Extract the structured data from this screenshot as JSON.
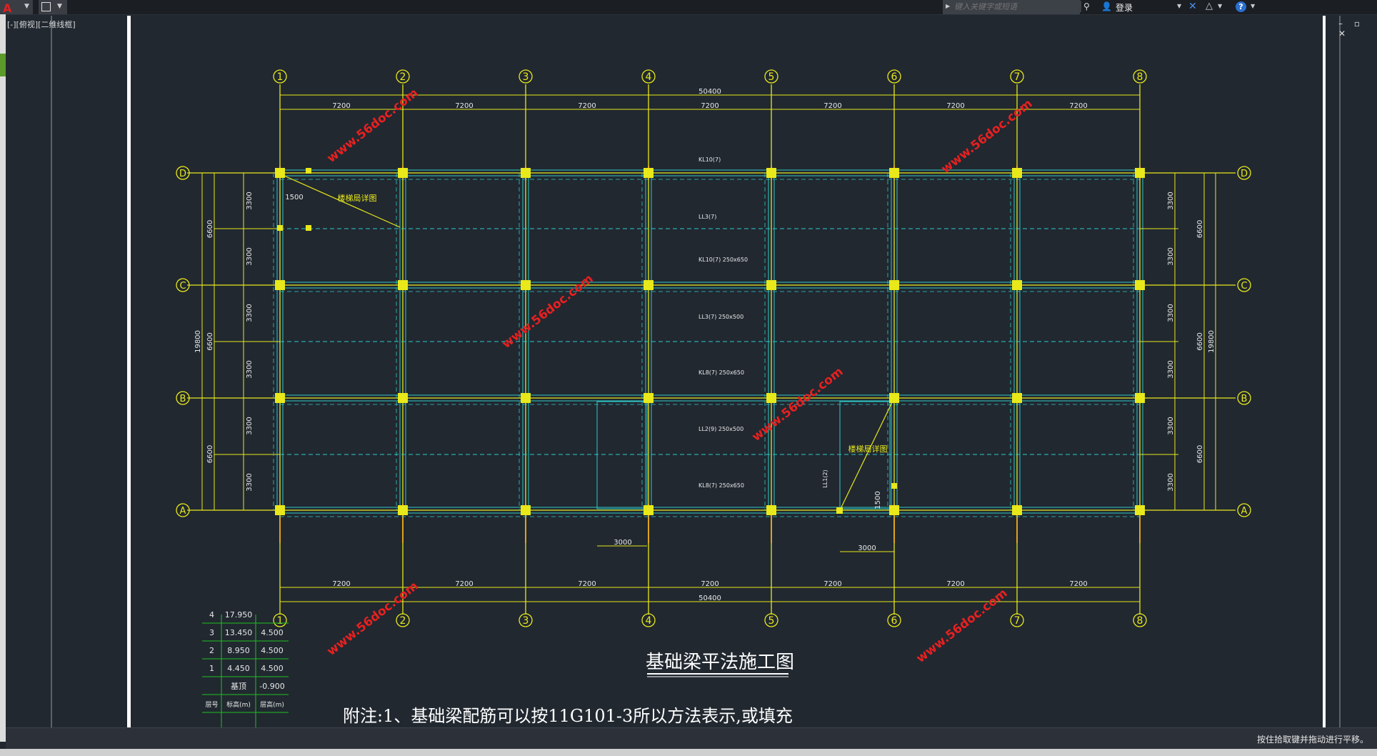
{
  "app": {
    "search_placeholder": "键入关键字或短语",
    "login_label": "登录",
    "viewport_label": "[-][俯视][二维线框]",
    "status_text": "按住拾取键并拖动进行平移。",
    "help_label": "?"
  },
  "drawing": {
    "title": "基础梁平法施工图",
    "note": "附注:1、基础梁配筋可以按11G101-3所以方法表示,或填充",
    "columns": [
      "1",
      "2",
      "3",
      "4",
      "5",
      "6",
      "7",
      "8"
    ],
    "rows": [
      "D",
      "C",
      "B",
      "A"
    ],
    "bay_dims": [
      "7200",
      "7200",
      "7200",
      "7200",
      "7200",
      "7200",
      "7200"
    ],
    "total_x": "50400",
    "left_dims_3300": [
      "3300",
      "3300",
      "3300",
      "3300",
      "3300",
      "3300"
    ],
    "left_dims_6600": [
      "6600",
      "6600",
      "6600"
    ],
    "total_y": "19800",
    "stair_labels": [
      "楼梯局详图",
      "楼梯局详图"
    ],
    "dim_1500": "1500",
    "dim_3000": "3000",
    "watermark": "www.56doc.com",
    "beam_labels": [
      "KL10(7)",
      "LL3(7)",
      "KL10(7) 250x650",
      "LL3(7) 250x500",
      "KL8(7) 250x650",
      "LL2(9) 250x500",
      "KL8(7) 250x650",
      "LL1(2)"
    ],
    "level_table": [
      [
        "4",
        "17.950",
        ""
      ],
      [
        "3",
        "13.450",
        "4.500"
      ],
      [
        "2",
        "8.950",
        "4.500"
      ],
      [
        "1",
        "4.450",
        "4.500"
      ],
      [
        "",
        "基顶",
        "-0.900"
      ],
      [
        "层号",
        "标高(m)",
        "层高(m)"
      ]
    ]
  }
}
